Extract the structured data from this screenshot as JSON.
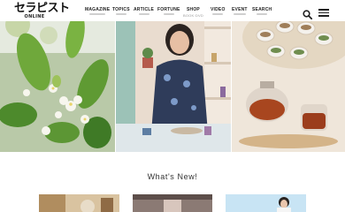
{
  "logo": {
    "main": "セラピスト",
    "sub": "ONLINE"
  },
  "nav": {
    "items": [
      {
        "label": "MAGAZINE"
      },
      {
        "label": "TOPICS"
      },
      {
        "label": "ARTICLE"
      },
      {
        "label": "FORTUNE"
      },
      {
        "label": "SHOP"
      },
      {
        "label": "VIDEO"
      },
      {
        "label": "EVENT"
      },
      {
        "label": "SEARCH"
      }
    ],
    "shop_sub": "BOOK·DVD"
  },
  "icons": {
    "search": "search-icon",
    "menu": "hamburger-menu-icon"
  },
  "sections": {
    "whats_new": "What's New!"
  },
  "colors": {
    "text": "#222222",
    "subtitle_bar": "#cfcfcf",
    "background": "#ffffff"
  }
}
